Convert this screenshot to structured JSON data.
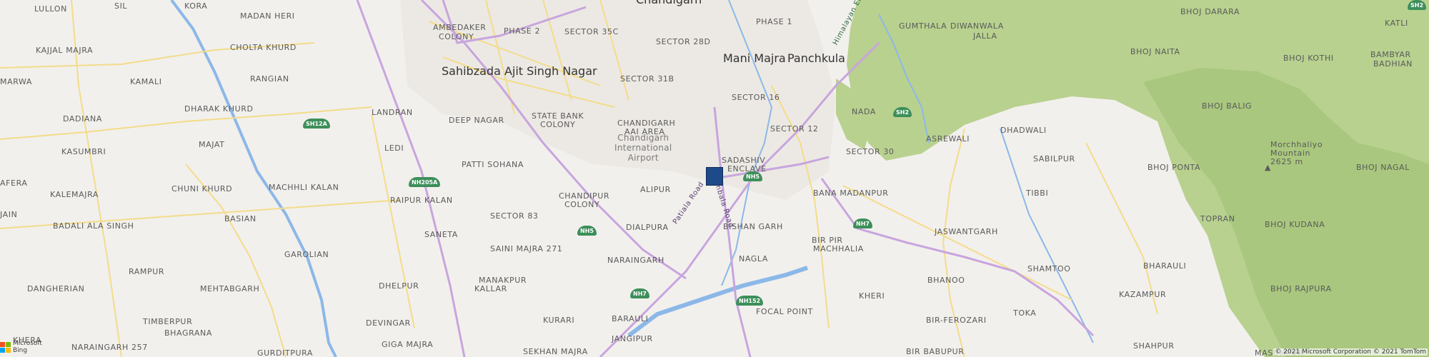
{
  "map": {
    "colors": {
      "land": "#f2f0ed",
      "forest": "#b8d18f",
      "water": "#8cb8e8",
      "major_road": "#c8a5de",
      "minor_road": "#f3dc8a",
      "highway_shield": "#3d8f5a",
      "marker": "#1e4a8a"
    },
    "cities": {
      "sahibzada": "Sahibzada Ajit Singh Nagar",
      "mani_majra": "Mani Majra",
      "panchkula": "Panchkula",
      "chandigarh_partial": "Chandigarh"
    },
    "airport": {
      "line1": "Chandigarh",
      "line2": "International",
      "line3": "Airport"
    },
    "places": {
      "lullon": "LULLON",
      "sil": "SIL",
      "kora": "KORA",
      "madan_heri": "MADAN HERI",
      "ambedaker": "AMBEDAKER",
      "colony": "COLONY",
      "phase2": "PHASE 2",
      "sector35c": "SECTOR 35C",
      "phase1": "PHASE 1",
      "diwanwala": "DIWANWALA",
      "jalla": "JALLA",
      "bhoj_darara": "BHOJ DARARA",
      "katli": "KATLI",
      "kajjal_majra": "KAJJAL MAJRA",
      "cholta_khurd": "CHOLTA KHURD",
      "sector28d": "SECTOR 28D",
      "gumthala": "GUMTHALA",
      "bhoj_naita": "BHOJ NAITA",
      "bhoj_kothi": "BHOJ KOTHI",
      "bambyar": "BAMBYAR",
      "badhian": "BADHIAN",
      "marwa": "MARWA",
      "kamali": "KAMALI",
      "rangian": "RANGIAN",
      "sector31b": "SECTOR 31B",
      "sector16": "SECTOR 16",
      "nada": "NADA",
      "bhoj_balig": "BHOJ BALIG",
      "dadiana": "DADIANA",
      "dharak_khurd": "DHARAK KHURD",
      "landran": "LANDRAN",
      "deep_nagar": "DEEP NAGAR",
      "state_bank": "STATE BANK",
      "chandigarh_caps": "CHANDIGARH",
      "aai_area": "AAI AREA",
      "sector12": "SECTOR 12",
      "dhadwali": "DHADWALI",
      "kasumbri": "KASUMBRI",
      "majat": "MAJAT",
      "ledi": "LEDI",
      "asrewali": "ASREWALI",
      "morchhaliyo": "Morchhaliyo",
      "mountain": "Mountain",
      "elevation": "2625 m",
      "afera": "AFERA",
      "sadashiv": "SADASHIV",
      "enclave": "ENCLAVE",
      "sector30": "SECTOR 30",
      "sabilpur": "SABILPUR",
      "bhoj_ponta": "BHOJ PONTA",
      "bhoj_nagal": "BHOJ NAGAL",
      "kalemajra": "KALEMAJRA",
      "chuni_khurd": "CHUNI KHURD",
      "machhli_kalan": "MACHHLI KALAN",
      "patti_sohana": "PATTI SOHANA",
      "alipur": "ALIPUR",
      "tibbi": "TIBBI",
      "bana_madanpur": "BANA MADANPUR",
      "raipur_kalan": "RAIPUR KALAN",
      "chandipur": "CHANDIPUR",
      "jain": "JAIN",
      "basian": "BASIAN",
      "sector83": "SECTOR 83",
      "topran": "TOPRAN",
      "badali": "BADALI ALA SINGH",
      "saneta": "SANETA",
      "dialpura": "DIALPURA",
      "bishan_garh": "BISHAN GARH",
      "jaswantgarh": "JASWANTGARH",
      "bhoj_kudana": "BHOJ KUDANA",
      "bir_pir": "BIR PIR",
      "machhalia": "MACHHALIA",
      "garolian": "GAROLIAN",
      "saini_majra": "SAINI MAJRA 271",
      "naraingarh": "NARAINGARH",
      "shamtoo": "SHAMTOO",
      "bharauli": "BHARAULI",
      "rampur": "RAMPUR",
      "nagla": "NAGLA",
      "bhanoo": "BHANOO",
      "manakpur": "MANAKPUR",
      "kallar": "KALLAR",
      "dangherian": "DANGHERIAN",
      "mehtabgarh": "MEHTABGARH",
      "dhelpur": "DHELPUR",
      "kheri": "KHERI",
      "kazampur": "KAZAMPUR",
      "bhoj_rajpura": "BHOJ RAJPURA",
      "timberpur": "TIMBERPUR",
      "devingar": "DEVINGAR",
      "kurari": "KURARI",
      "barauli": "BARAULI",
      "focal_point": "FOCAL POINT",
      "bir_ferozari": "BIR-FEROZARI",
      "toka": "TOKA",
      "bhagrana": "BHAGRANA",
      "jangipur": "JANGIPUR",
      "shahpur": "SHAHPUR",
      "khera": "KHERA",
      "naraingarh257": "NARAINGARH 257",
      "giga_majra": "GIGA MAJRA",
      "sekhan_majra": "SEKHAN MAJRA",
      "bir_babupur": "BIR BABUPUR",
      "masumpur": "MASUMPUR",
      "gurditpura": "GURDITPURA"
    },
    "roads": {
      "patiala_road": "Patiala Road",
      "ambala_road": "Ambala Road",
      "himalayan_exp": "Himalayan Ekspr"
    },
    "shields": {
      "sh2_top": "SH2",
      "sh12a": "SH12A",
      "sh2": "SH2",
      "nh205a": "NH205A",
      "nh5_a": "NH5",
      "nh5_b": "NH5",
      "nh7_a": "NH7",
      "nh7_b": "NH7",
      "nh152": "NH152"
    },
    "logo": {
      "line1": "Microsoft",
      "line2": "Bing",
      "colors": [
        "#f25022",
        "#7fba00",
        "#00a4ef",
        "#ffb900"
      ]
    },
    "copyright": "© 2021 Microsoft Corporation © 2021 TomTom"
  }
}
